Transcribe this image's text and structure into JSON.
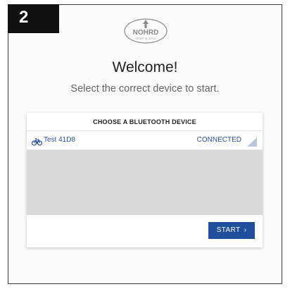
{
  "step_number": "2",
  "logo": {
    "brand": "NOHRD",
    "tagline": "SPORT IN STYLE"
  },
  "welcome": {
    "title": "Welcome!",
    "subtitle": "Select the correct device to start."
  },
  "device_card": {
    "header": "CHOOSE A BLUETOOTH DEVICE",
    "devices": [
      {
        "name": "Test 41D8",
        "status": "CONNECTED",
        "icon": "bike-icon",
        "signal_icon": "signal-strength-icon"
      }
    ],
    "start_label": "START",
    "start_icon": "chevron-right-icon"
  },
  "colors": {
    "accent": "#1f4f9c",
    "device_text": "#2a4fa3",
    "empty_list_bg": "#d9d9d9"
  }
}
